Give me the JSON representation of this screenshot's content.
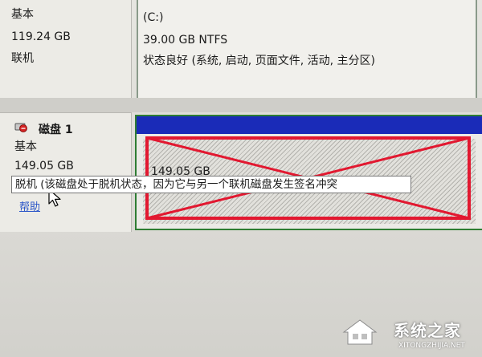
{
  "disk0": {
    "type": "基本",
    "size": "119.24 GB",
    "status": "联机",
    "partition": {
      "name": "(C:)",
      "size_fs": "39.00 GB NTFS",
      "status": "状态良好 (系统, 启动, 页面文件, 活动, 主分区)"
    }
  },
  "disk1": {
    "title": "磁盘 1",
    "type": "基本",
    "size": "149.05 GB",
    "help_link": "帮助",
    "icon": "disk-offline-icon",
    "partition": {
      "size": "149.05 GB"
    }
  },
  "tooltip": {
    "text": "脱机 (该磁盘处于脱机状态，因为它与另一个联机磁盘发生签名冲突"
  },
  "watermark": {
    "brand": "系统之家",
    "url": "XITONGZHIJIA.NET"
  },
  "colors": {
    "partition_header": "#1a2bb8",
    "partition_border": "#2e7d33",
    "annotation_red": "#e21830",
    "link": "#2a55c8"
  }
}
